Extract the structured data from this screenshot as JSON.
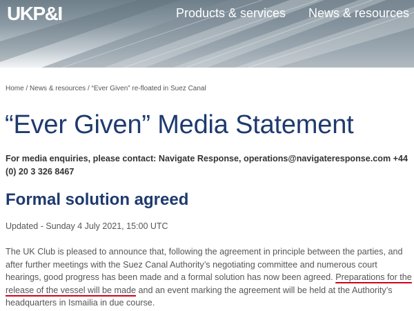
{
  "header": {
    "logo": "UKP&I",
    "nav": [
      {
        "label": "Products & services"
      },
      {
        "label": "News & resources"
      }
    ]
  },
  "breadcrumb": {
    "items": [
      "Home",
      "News & resources",
      "“Ever Given” re-floated in Suez Canal"
    ],
    "separator": "/"
  },
  "article": {
    "title": "“Ever Given” Media Statement",
    "contact": "For media enquiries, please contact: Navigate Response, operations@navigateresponse.com +44 (0) 20 3 326 8467",
    "section_heading": "Formal solution agreed",
    "updated": "Updated - Sunday 4 July 2021, 15:00 UTC",
    "body_part1": "The UK Club is pleased to announce that, following the agreement in principle between the parties, and after further meetings with the Suez Canal Authority’s negotiating committee and numerous court hearings, good progress has been made and a formal solution has now been agreed. ",
    "body_highlight": "Preparations for the release of the vessel will be made",
    "body_part2": " and an event marking the agreement will be held at the Authority’s headquarters in Ismailia in due course."
  },
  "colors": {
    "title": "#1e3a6e",
    "highlight_underline": "#d0021b"
  }
}
